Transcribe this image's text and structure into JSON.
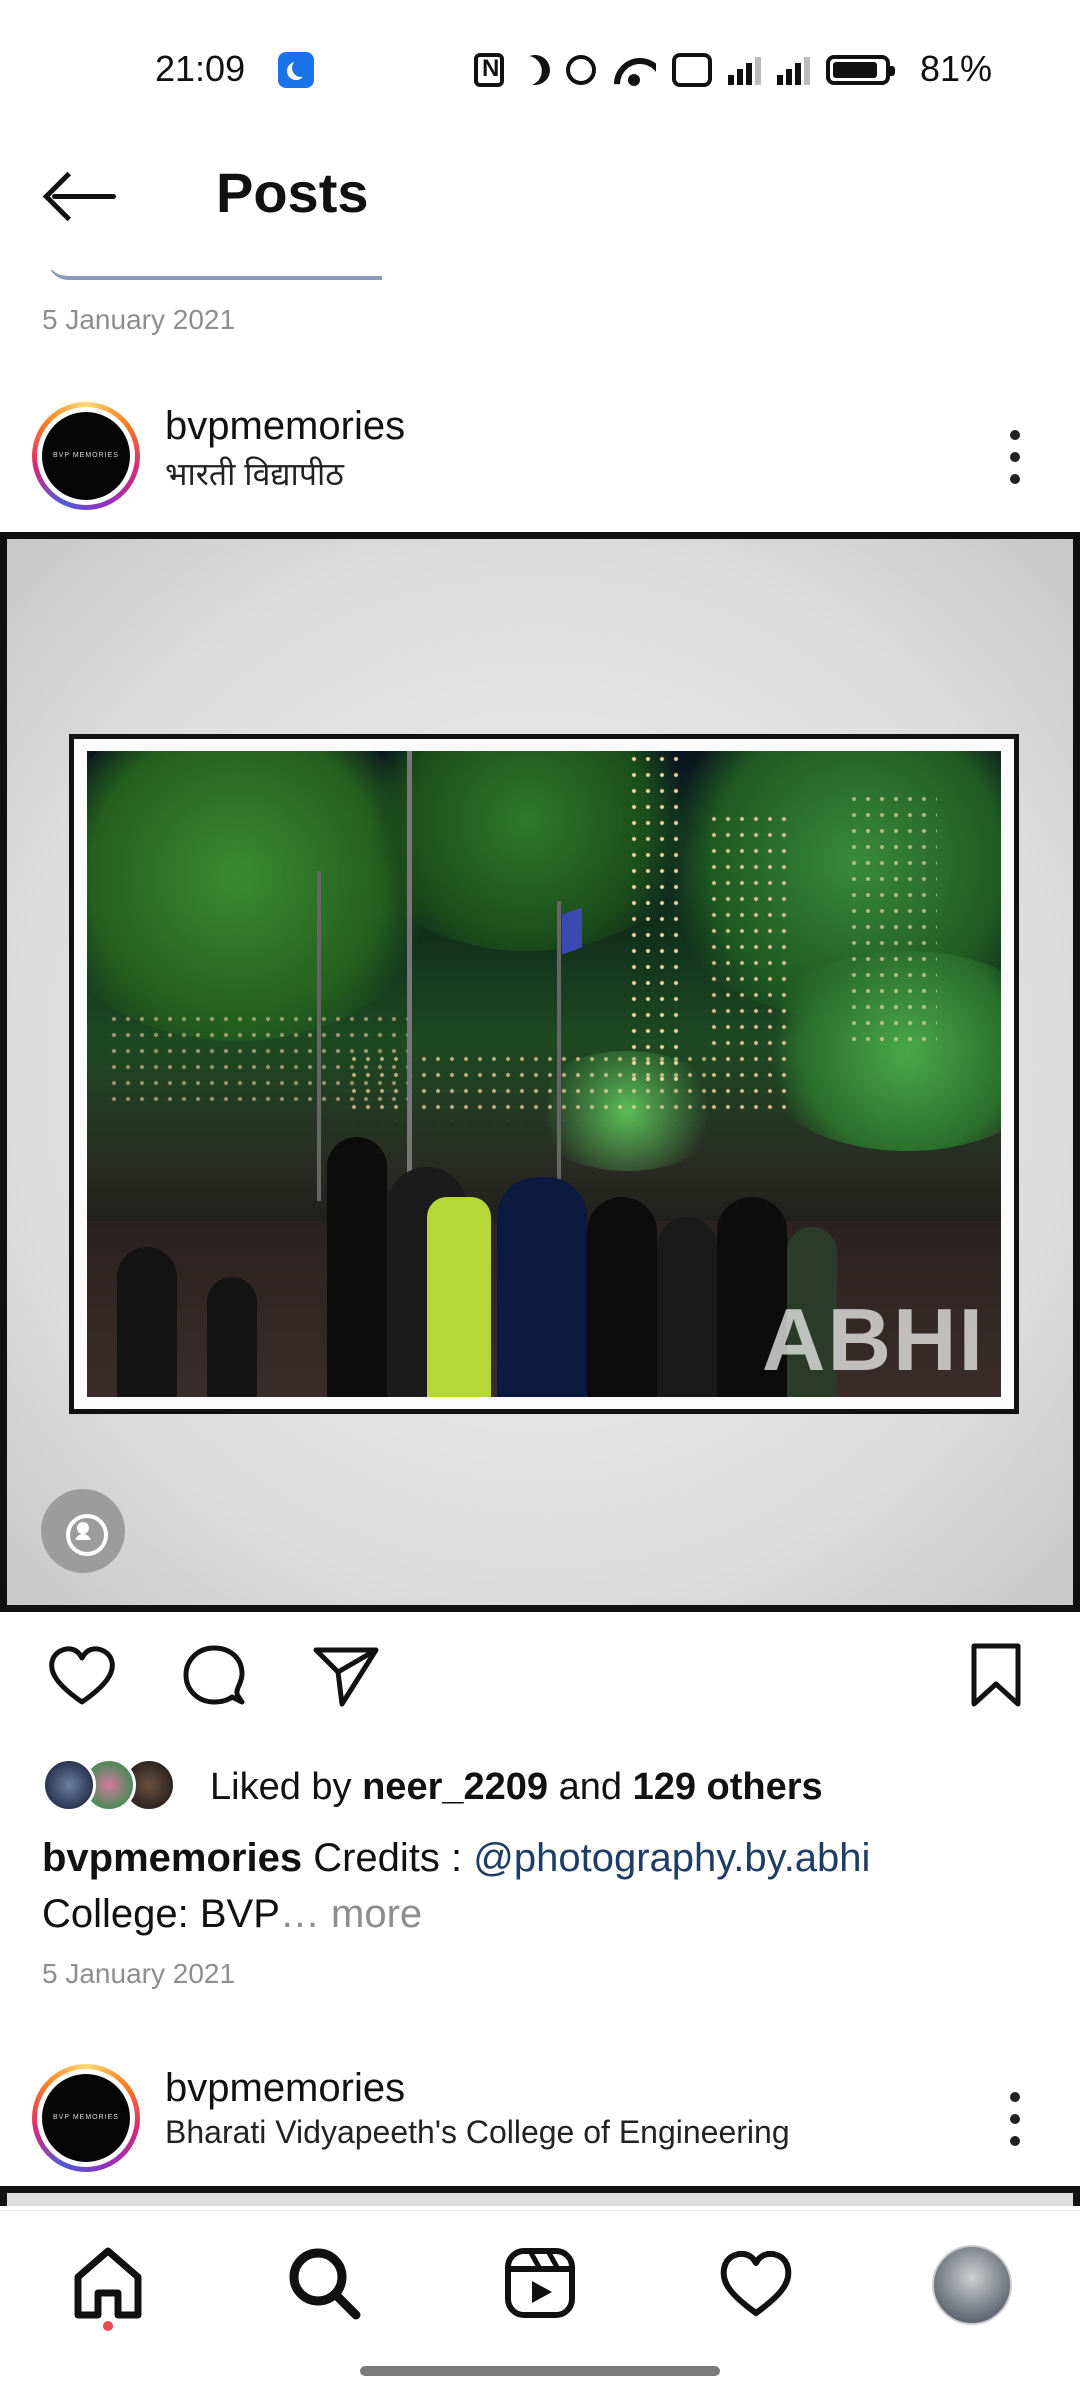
{
  "status_bar": {
    "time": "21:09",
    "battery_pct": "81%"
  },
  "header": {
    "title": "Posts"
  },
  "previous_post": {
    "date": "5 January 2021"
  },
  "post": {
    "username": "bvpmemories",
    "location": "भारती विद्यापीठ",
    "avatar_text": "BVP MEMORIES",
    "image_watermark": "ABHI",
    "likes": {
      "prefix": "Liked by ",
      "user": "neer_2209",
      "middle": " and ",
      "others": "129 others"
    },
    "caption": {
      "username": "bvpmemories",
      "text_before": " Credits : ",
      "mention": "@photography.by.abhi",
      "line2": "College: BVP",
      "more": "… more"
    },
    "date": "5 January 2021"
  },
  "next_post": {
    "username": "bvpmemories",
    "location": "Bharati Vidyapeeth's College of Engineering",
    "avatar_text": "BVP MEMORIES"
  },
  "bottom_nav": {
    "items": [
      "home-icon",
      "search-icon",
      "reels-icon",
      "activity-heart-icon",
      "profile-avatar"
    ]
  },
  "colors": {
    "accent_link": "#1e3d64",
    "notification_dot": "#ed4956",
    "muted": "#8e8e8e"
  }
}
